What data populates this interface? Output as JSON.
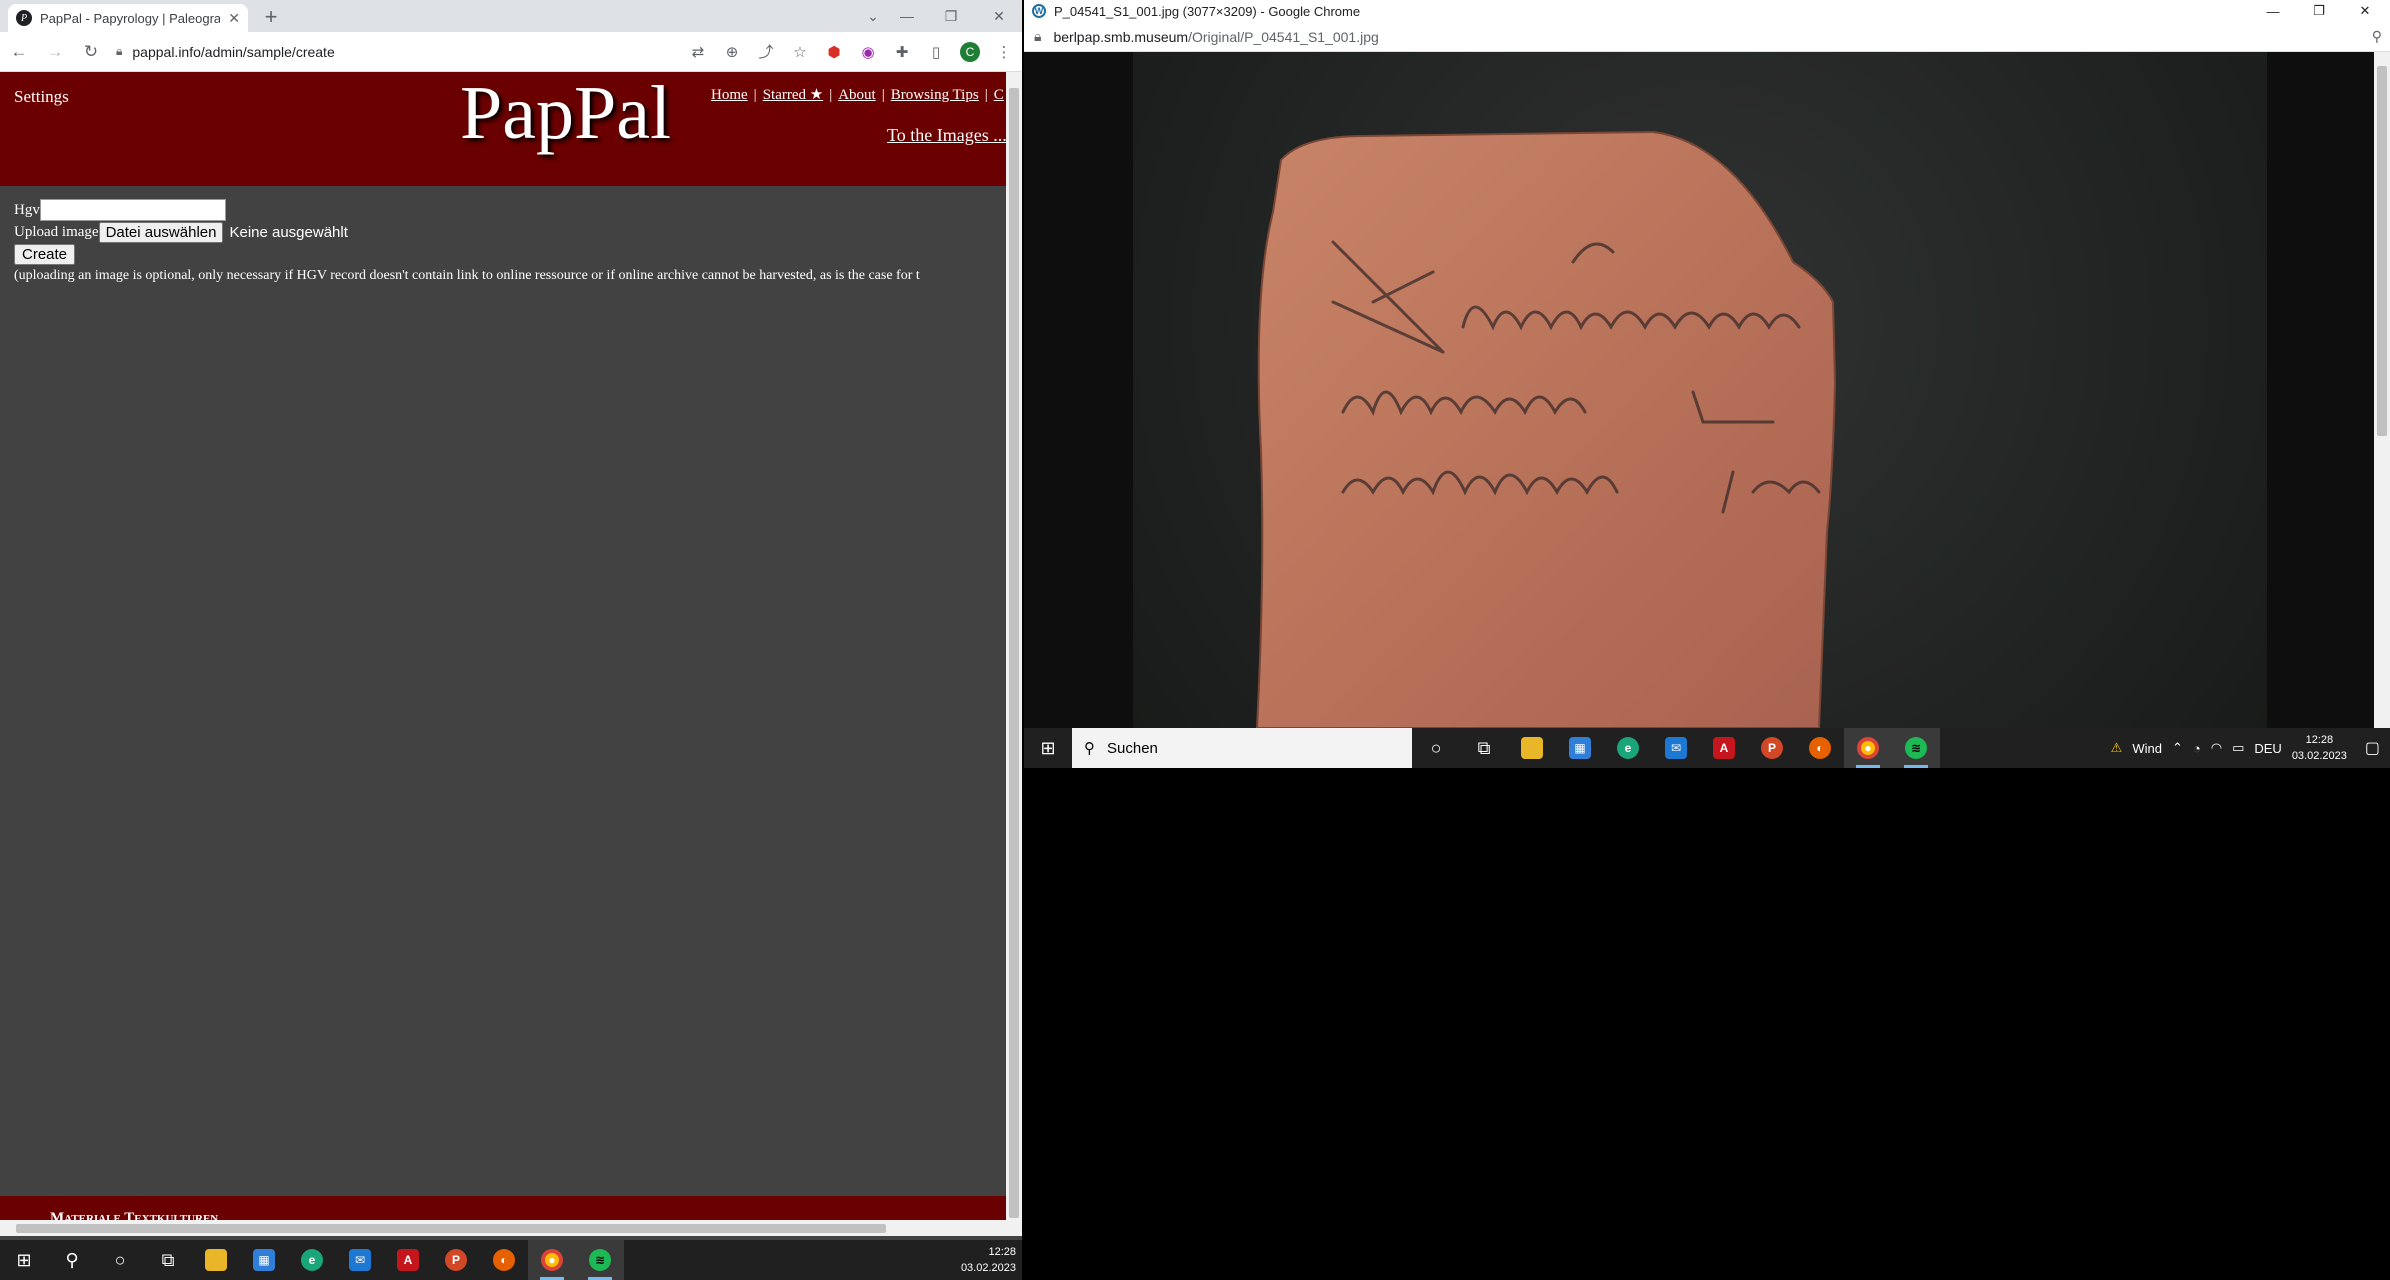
{
  "left_browser": {
    "tab_title": "PapPal - Papyrology | Paleograph",
    "new_tab": "+",
    "url": "pappal.info/admin/sample/create",
    "profile_initial": "C"
  },
  "pappal": {
    "settings": "Settings",
    "logo": "PapPal",
    "nav": [
      "Home",
      "Starred ★",
      "About",
      "Browsing Tips",
      "C"
    ],
    "to_images": "To the Images ...",
    "form": {
      "hgv_label": "Hgv",
      "hgv_value": "",
      "upload_label": "Upload image",
      "file_button": "Datei auswählen",
      "file_status": "Keine ausgewählt",
      "create_button": "Create",
      "note": "(uploading an image is optional, only necessary if HGV record doesn't contain link to online ressource or if online archive cannot be harvested, as is the case for t"
    },
    "footer": "Materiale Textkulturen"
  },
  "left_taskbar": {
    "time": "12:28",
    "date": "03.02.2023"
  },
  "right_browser": {
    "title": "P_04541_S1_001.jpg (3077×3209) - Google Chrome",
    "url_host": "berlpap.smb.museum",
    "url_path": "/Original/P_04541_S1_001.jpg",
    "image_alt": "P_04541_S1_001.jpg"
  },
  "right_taskbar": {
    "search": "Suchen",
    "weather": "Wind",
    "language": "DEU",
    "time": "12:28",
    "date": "03.02.2023"
  },
  "colors": {
    "header": "#6b0000",
    "page_bg": "#424242",
    "taskbar": "#202020"
  }
}
